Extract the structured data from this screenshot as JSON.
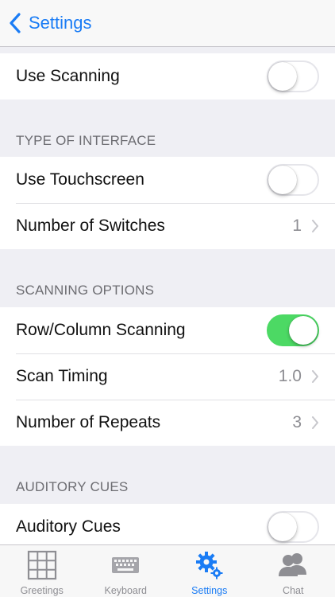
{
  "nav": {
    "back_label": "Settings"
  },
  "rows": {
    "use_scanning": {
      "label": "Use Scanning",
      "on": false
    },
    "use_touchscreen": {
      "label": "Use Touchscreen",
      "on": false
    },
    "number_of_switches": {
      "label": "Number of Switches",
      "value": "1"
    },
    "row_column_scanning": {
      "label": "Row/Column Scanning",
      "on": true
    },
    "scan_timing": {
      "label": "Scan Timing",
      "value": "1.0"
    },
    "number_of_repeats": {
      "label": "Number of Repeats",
      "value": "3"
    },
    "auditory_cues": {
      "label": "Auditory Cues",
      "on": false
    }
  },
  "sections": {
    "type_of_interface": "TYPE OF INTERFACE",
    "scanning_options": "SCANNING OPTIONS",
    "auditory_cues": "AUDITORY CUES"
  },
  "tabs": [
    {
      "label": "Greetings",
      "icon": "grid-icon"
    },
    {
      "label": "Keyboard",
      "icon": "keyboard-icon"
    },
    {
      "label": "Settings",
      "icon": "gears-icon",
      "active": true
    },
    {
      "label": "Chat",
      "icon": "people-icon"
    }
  ],
  "colors": {
    "accent": "#1a7cf5",
    "toggle_on": "#4cd964",
    "background": "#efeff4"
  }
}
